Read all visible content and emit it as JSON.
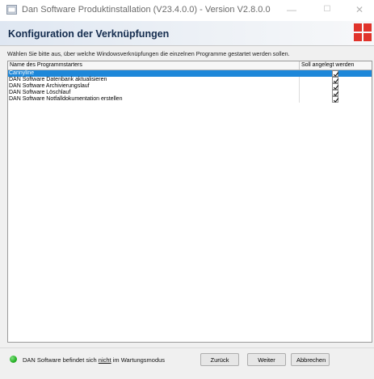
{
  "window": {
    "title": "Dan Software Produktinstallation (V23.4.0.0) - Version V2.8.0.0",
    "minimize_glyph": "—",
    "maximize_glyph": "☐",
    "close_glyph": "✕"
  },
  "header": {
    "heading": "Konfiguration der Verknüpfungen",
    "logo_icon": "dan-logo-icon"
  },
  "description": "Wählen Sie bitte aus, über welche Windowsverknüpfungen die einzelnen Programme gestartet werden sollen.",
  "table": {
    "columns": [
      "Name des Programmstarters",
      "Soll angelegt werden"
    ],
    "rows": [
      {
        "name": "Cannyline",
        "checked": true,
        "selected": true
      },
      {
        "name": "DAN Software Datenbank aktualisieren",
        "checked": true,
        "selected": false
      },
      {
        "name": "DAN Software Archivierungslauf",
        "checked": true,
        "selected": false
      },
      {
        "name": "DAN Software Löschlauf",
        "checked": true,
        "selected": false
      },
      {
        "name": "DAN Software Notfalldokumentation erstellen",
        "checked": true,
        "selected": false
      }
    ]
  },
  "status": {
    "prefix": "DAN Software befindet sich ",
    "emphasis": "nicht",
    "suffix": " im Wartungsmodus",
    "led_color": "#2bb52b"
  },
  "buttons": {
    "back": "Zurück",
    "next": "Weiter",
    "cancel": "Abbrechen"
  },
  "colors": {
    "selection": "#1d87d9",
    "heading": "#142c4e",
    "logo_red": "#e0332b"
  }
}
